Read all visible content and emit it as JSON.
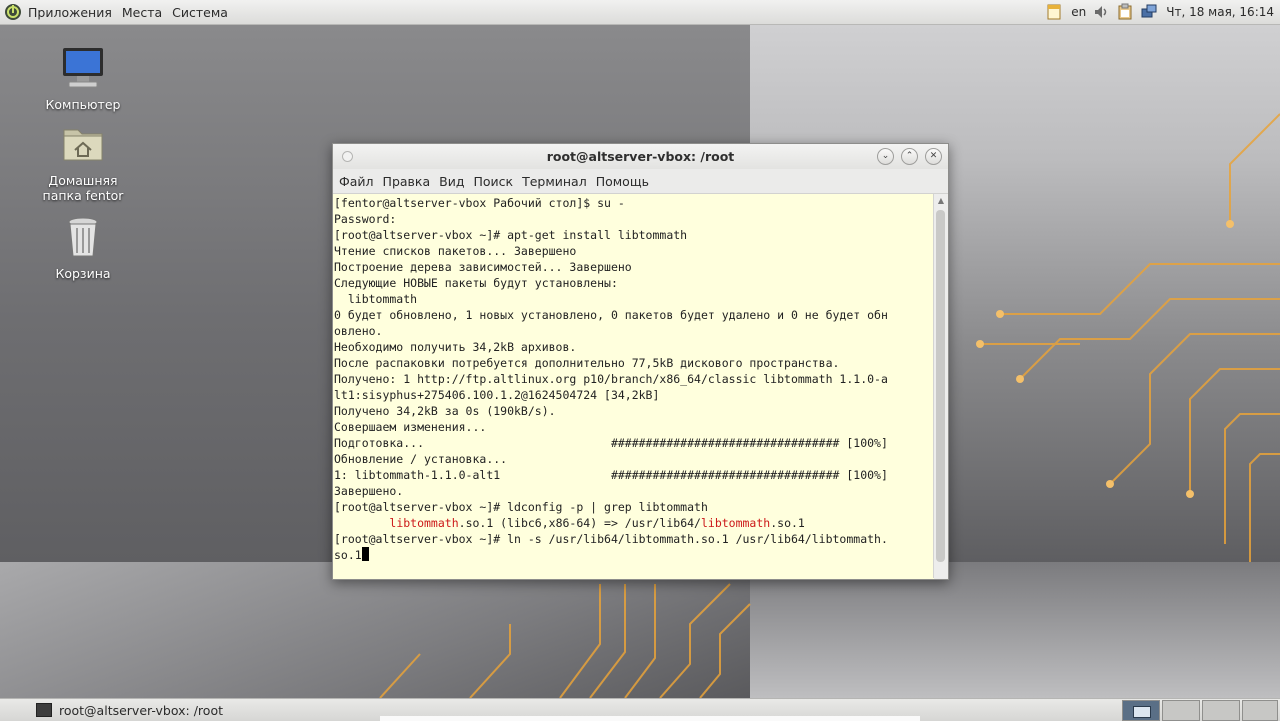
{
  "top_panel": {
    "menu": [
      "Приложения",
      "Места",
      "Система"
    ],
    "keyboard_layout": "en",
    "clock": "Чт, 18 мая, 16:14"
  },
  "desktop_icons": [
    {
      "label": "Компьютер",
      "icon": "computer-icon"
    },
    {
      "label": "Домашняя папка fentor",
      "icon": "home-folder-icon"
    },
    {
      "label": "Корзина",
      "icon": "trash-icon"
    }
  ],
  "window": {
    "title": "root@altserver-vbox: /root",
    "menu": [
      "Файл",
      "Правка",
      "Вид",
      "Поиск",
      "Терминал",
      "Помощь"
    ],
    "terminal_lines": [
      [
        {
          "t": "[fentor@altserver-vbox Рабочий стол]$ su -"
        }
      ],
      [
        {
          "t": "Password:"
        }
      ],
      [
        {
          "t": "[root@altserver-vbox ~]# apt-get install libtommath"
        }
      ],
      [
        {
          "t": "Чтение списков пакетов... Завершено"
        }
      ],
      [
        {
          "t": "Построение дерева зависимостей... Завершено"
        }
      ],
      [
        {
          "t": "Следующие НОВЫЕ пакеты будут установлены:"
        }
      ],
      [
        {
          "t": "  libtommath"
        }
      ],
      [
        {
          "t": "0 будет обновлено, 1 новых установлено, 0 пакетов будет удалено и 0 не будет обн"
        }
      ],
      [
        {
          "t": "овлено."
        }
      ],
      [
        {
          "t": "Необходимо получить 34,2kB архивов."
        }
      ],
      [
        {
          "t": "После распаковки потребуется дополнительно 77,5kB дискового пространства."
        }
      ],
      [
        {
          "t": "Получено: 1 http://ftp.altlinux.org p10/branch/x86_64/classic libtommath 1.1.0-a"
        }
      ],
      [
        {
          "t": "lt1:sisyphus+275406.100.1.2@1624504724 [34,2kB]"
        }
      ],
      [
        {
          "t": "Получено 34,2kB за 0s (190kB/s)."
        }
      ],
      [
        {
          "t": "Совершаем изменения..."
        }
      ],
      [
        {
          "t": "Подготовка...                           ################################# [100%]"
        }
      ],
      [
        {
          "t": "Обновление / установка..."
        }
      ],
      [
        {
          "t": "1: libtommath-1.1.0-alt1                ################################# [100%]"
        }
      ],
      [
        {
          "t": "Завершено."
        }
      ],
      [
        {
          "t": "[root@altserver-vbox ~]# ldconfig -p | grep libtommath"
        }
      ],
      [
        {
          "t": "        "
        },
        {
          "t": "libtommath",
          "hl": true
        },
        {
          "t": ".so.1 (libc6,x86-64) => /usr/lib64/"
        },
        {
          "t": "libtommath",
          "hl": true
        },
        {
          "t": ".so.1"
        }
      ],
      [
        {
          "t": "[root@altserver-vbox ~]# ln -s /usr/lib64/libtommath.so.1 /usr/lib64/libtommath."
        }
      ],
      [
        {
          "t": "so.1"
        },
        {
          "cursor": true
        }
      ]
    ]
  },
  "taskbar": {
    "task_label": "root@altserver-vbox: /root"
  },
  "colors": {
    "terminal_bg": "#ffffdd",
    "highlight": "#cc1a1a",
    "wallpaper_accent": "#e8a33a"
  }
}
